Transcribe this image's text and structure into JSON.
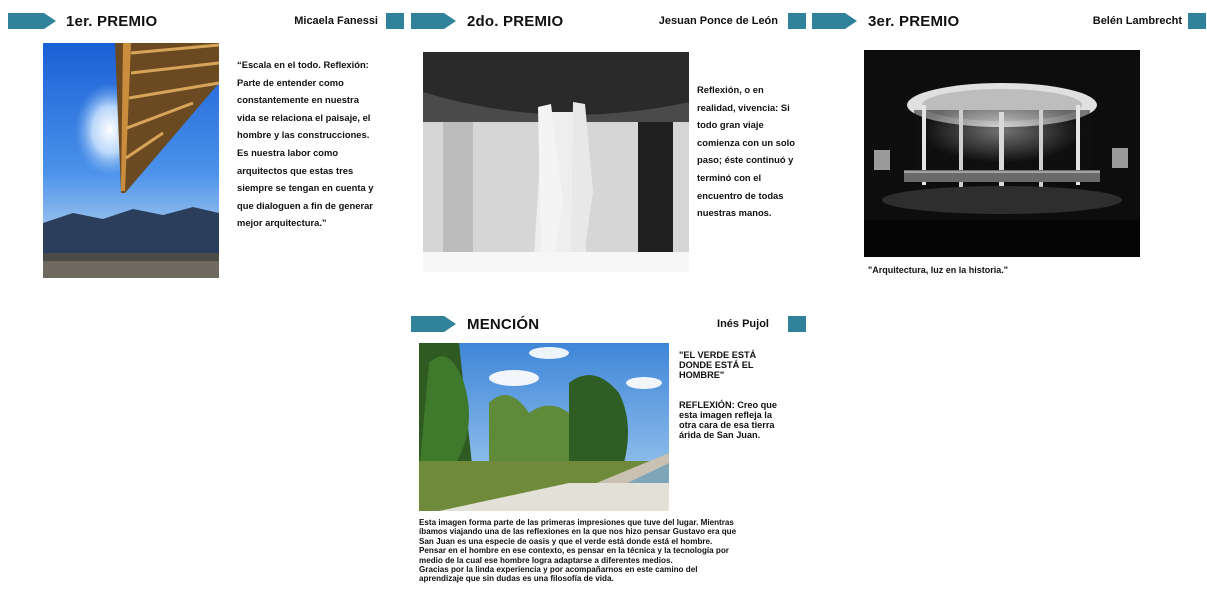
{
  "first": {
    "title": "1er. PREMIO",
    "author": "Micaela Fanessi",
    "text": "“Escala en el todo. Reflexión: Parte de entender como constantemente en nuestra vida se relaciona el paisaje, el hombre y las construcciones. Es nuestra labor como arquitectos que estas tres siempre se tengan en cuenta y que dialoguen a fin de generar mejor arquitectura.”"
  },
  "second": {
    "title": "2do. PREMIO",
    "author": "Jesuan Ponce de León",
    "text": "Reflexión, o en realidad, vivencia: Si todo gran viaje comienza con un solo paso; éste continuó y terminó con el encuentro de todas nuestras manos."
  },
  "third": {
    "title": "3er. PREMIO",
    "author": "Belén Lambrecht",
    "caption": "\"Arquitectura, luz en la historia.\""
  },
  "mention": {
    "title": "MENCIÓN",
    "author": "Inés Pujol",
    "quote": "\"EL VERDE ESTÁ DONDE ESTÁ EL HOMBRE\"",
    "reflection": "REFLEXIÓN: Creo que esta imagen refleja la otra cara de esa tierra árida de San Juan.",
    "paragraph": [
      "Esta imagen forma parte de las primeras impresiones que tuve del lugar. Mientras",
      "íbamos viajando una de las reflexiones en la que nos hizo pensar Gustavo era que",
      "San Juan es una especie de oasis y que el verde está donde está el hombre.",
      "Pensar en el hombre en ese contexto,  es pensar en la técnica y la tecnología por",
      "medio de la cual ese hombre logra adaptarse a diferentes medios.",
      "Gracias por la linda experiencia y por acompañarnos en este camino del",
      "aprendizaje que sin dudas es una filosofía de vida."
    ]
  },
  "colors": {
    "accent": "#2f8299"
  },
  "icons": {
    "arrow": "chevron-arrow-banner",
    "square": "accent-square"
  }
}
